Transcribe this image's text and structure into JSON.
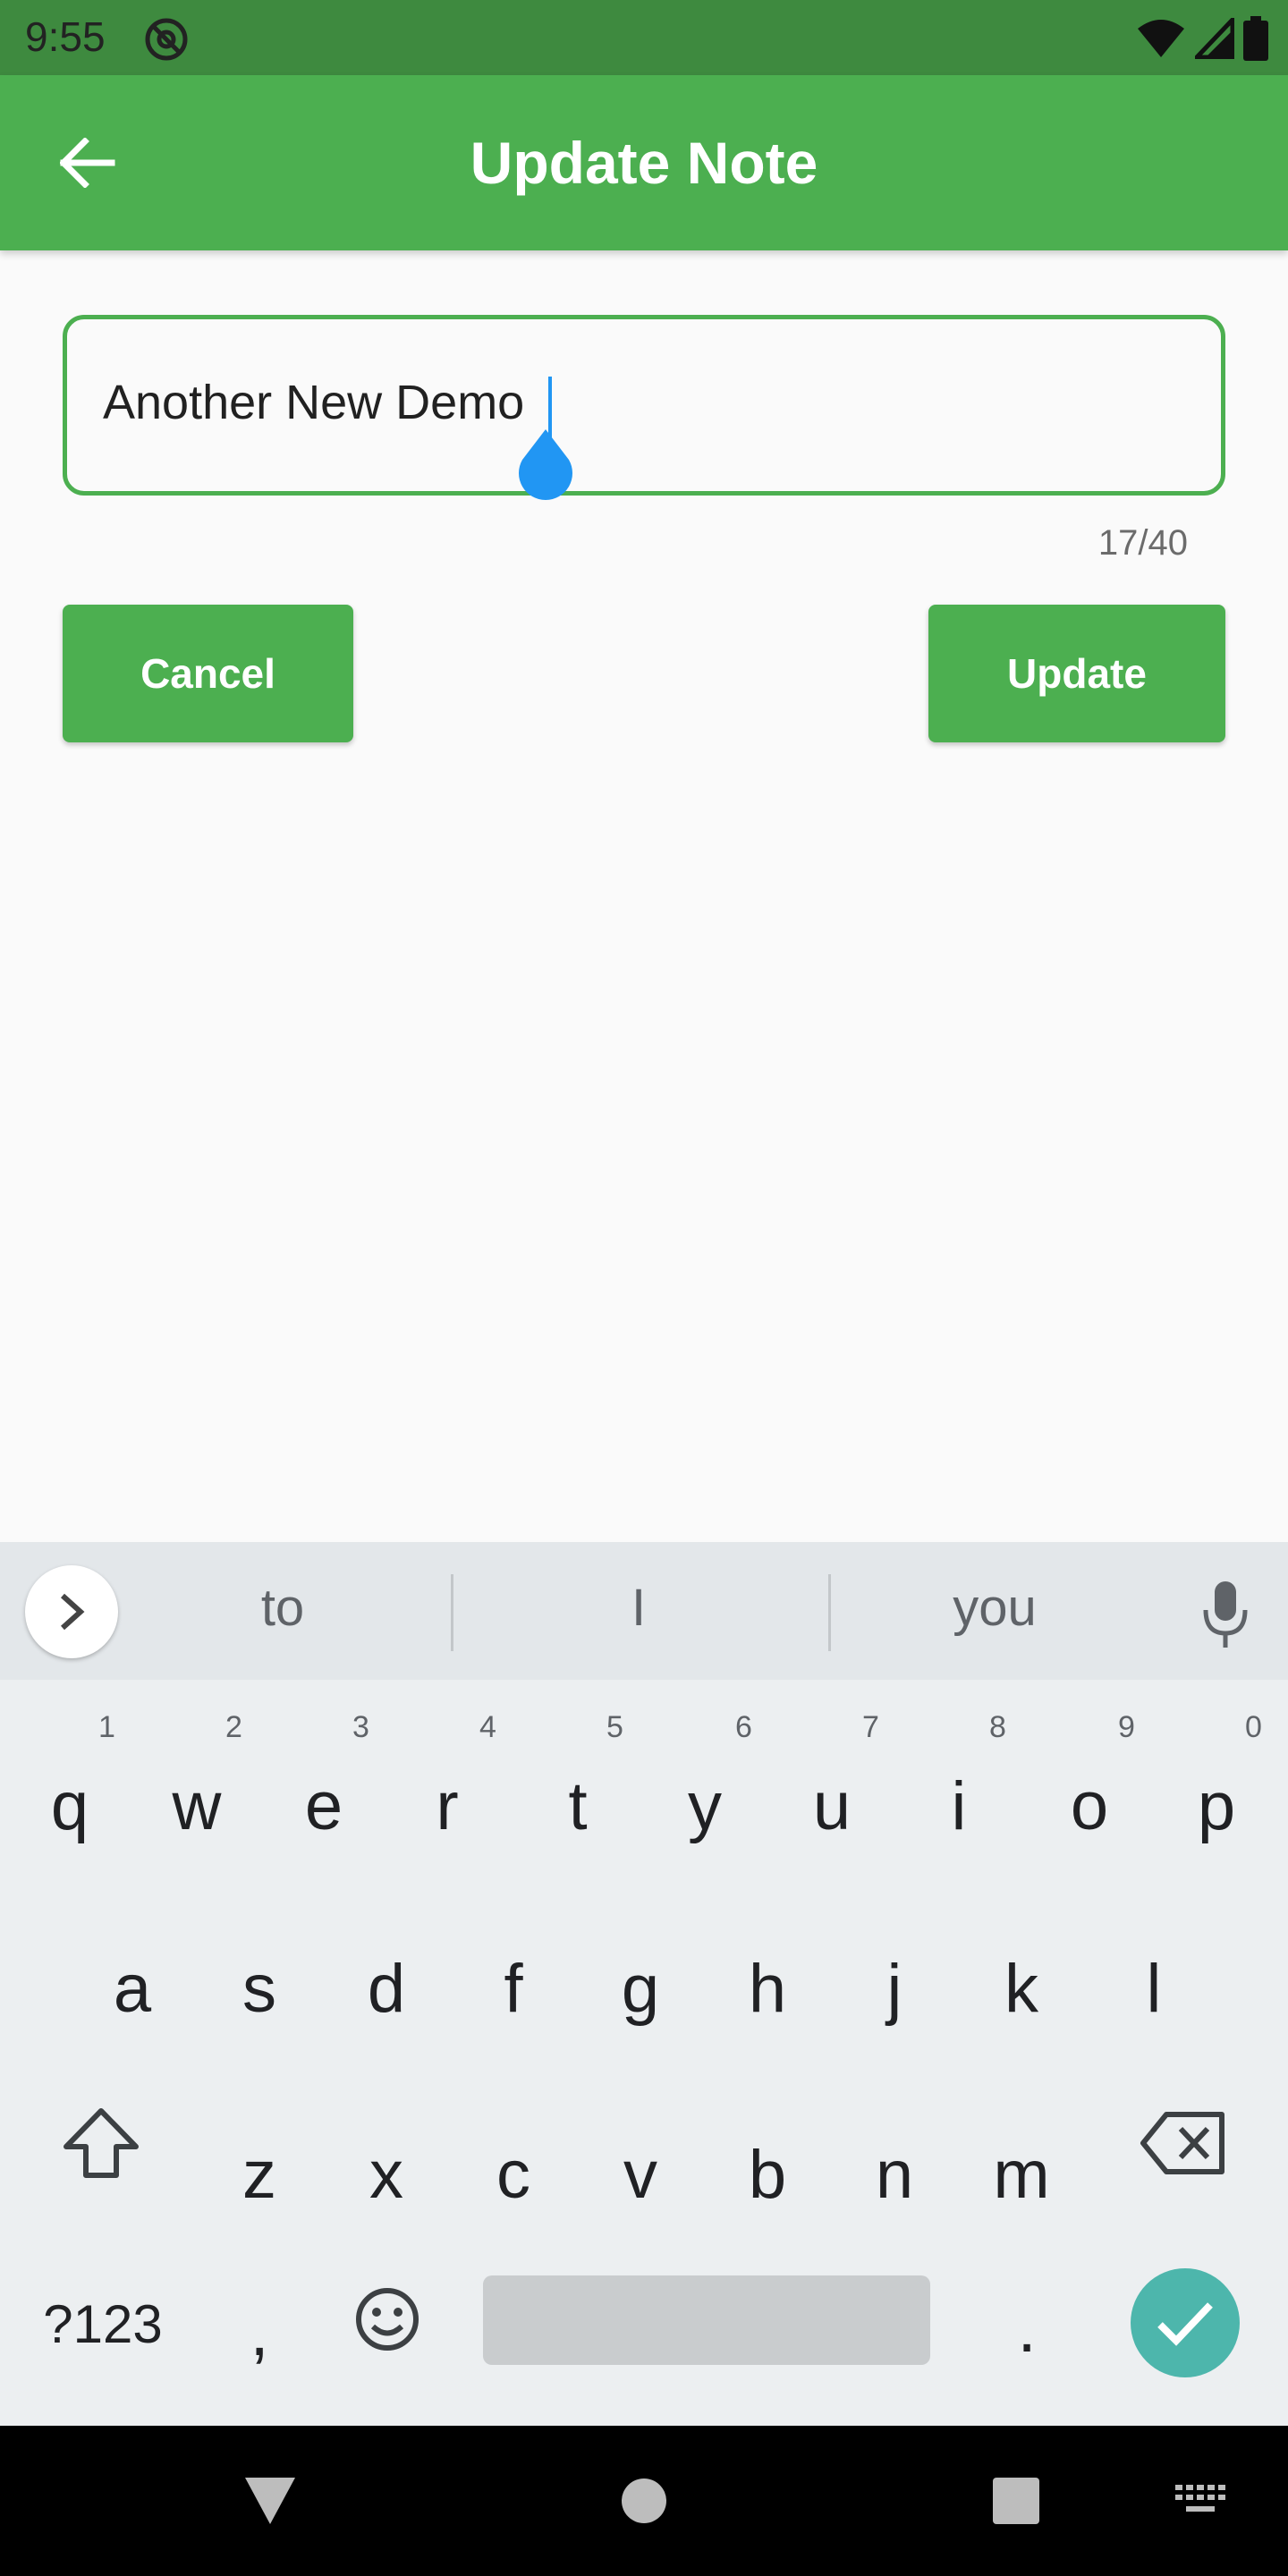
{
  "status_bar": {
    "time": "9:55"
  },
  "app_bar": {
    "title": "Update Note"
  },
  "note_field": {
    "value": "Another New Demo",
    "counter": "17/40"
  },
  "buttons": {
    "cancel_label": "Cancel",
    "update_label": "Update"
  },
  "keyboard": {
    "suggestions": [
      "to",
      "I",
      "you"
    ],
    "row1": [
      {
        "key": "q",
        "hint": "1"
      },
      {
        "key": "w",
        "hint": "2"
      },
      {
        "key": "e",
        "hint": "3"
      },
      {
        "key": "r",
        "hint": "4"
      },
      {
        "key": "t",
        "hint": "5"
      },
      {
        "key": "y",
        "hint": "6"
      },
      {
        "key": "u",
        "hint": "7"
      },
      {
        "key": "i",
        "hint": "8"
      },
      {
        "key": "o",
        "hint": "9"
      },
      {
        "key": "p",
        "hint": "0"
      }
    ],
    "row2": [
      "a",
      "s",
      "d",
      "f",
      "g",
      "h",
      "j",
      "k",
      "l"
    ],
    "row3": [
      "z",
      "x",
      "c",
      "v",
      "b",
      "n",
      "m"
    ],
    "symbols_label": "?123",
    "comma": ",",
    "period": "."
  },
  "colors": {
    "primary": "#4caf50",
    "status_bar": "#3e8a3f",
    "cursor": "#2196f3",
    "enter_key": "#4db6ac"
  }
}
